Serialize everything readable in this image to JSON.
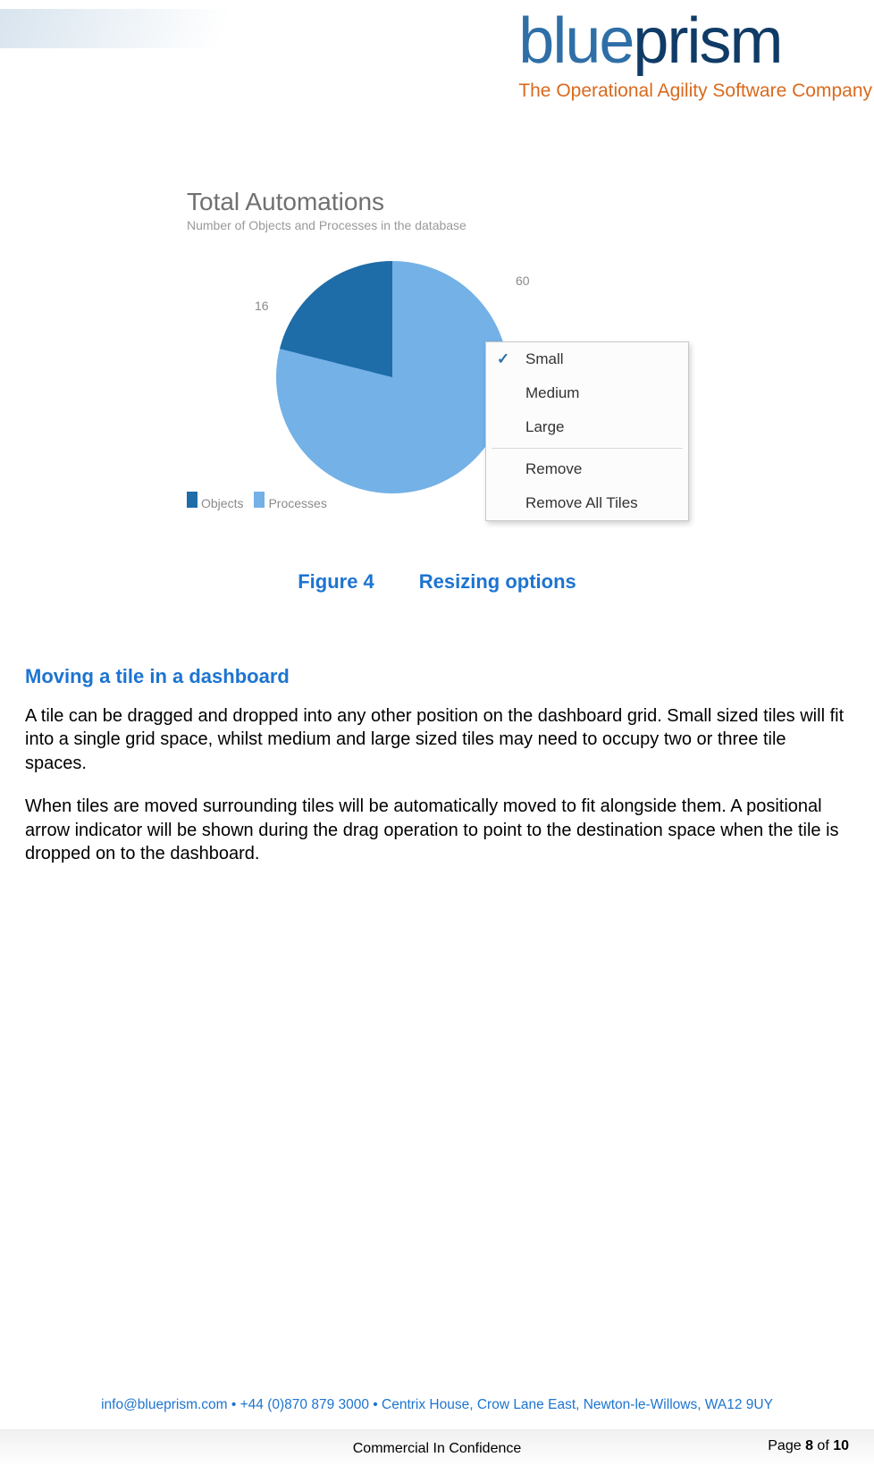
{
  "header": {
    "logo_blue": "blue",
    "logo_prism": "prism",
    "tagline": "The Operational Agility Software Company"
  },
  "chart_data": {
    "type": "pie",
    "title": "Total Automations",
    "subtitle": "Number of Objects and Processes in the database",
    "series": [
      {
        "name": "Objects",
        "value": 16,
        "color": "#1e6ca8"
      },
      {
        "name": "Processes",
        "value": 60,
        "color": "#73b1e7"
      }
    ],
    "labels": {
      "left": "16",
      "right": "60"
    },
    "legend": [
      "Objects",
      "Processes"
    ]
  },
  "context_menu": {
    "items": [
      {
        "label": "Small",
        "checked": true
      },
      {
        "label": "Medium",
        "checked": false
      },
      {
        "label": "Large",
        "checked": false
      }
    ],
    "footer_items": [
      {
        "label": "Remove"
      },
      {
        "label": "Remove All Tiles"
      }
    ]
  },
  "figure_caption": {
    "number": "Figure 4",
    "text": "Resizing options"
  },
  "section": {
    "heading": "Moving a tile in a dashboard",
    "para1": "A tile can be dragged and dropped into any other position on the dashboard grid. Small sized tiles will fit into a single grid space, whilst medium and large sized tiles may need to occupy two or three tile spaces.",
    "para2": "When tiles are moved surrounding tiles will be automatically moved to fit alongside them. A positional arrow indicator will be shown during the drag operation to point to the destination space when the tile is dropped on to the dashboard."
  },
  "footer": {
    "contact": "info@blueprism.com  •  +44 (0)870 879 3000  •  Centrix House, Crow Lane East, Newton-le-Willows, WA12 9UY",
    "confidential": "Commercial In Confidence",
    "page_prefix": "Page ",
    "page_current": "8",
    "page_of": " of ",
    "page_total": "10"
  }
}
